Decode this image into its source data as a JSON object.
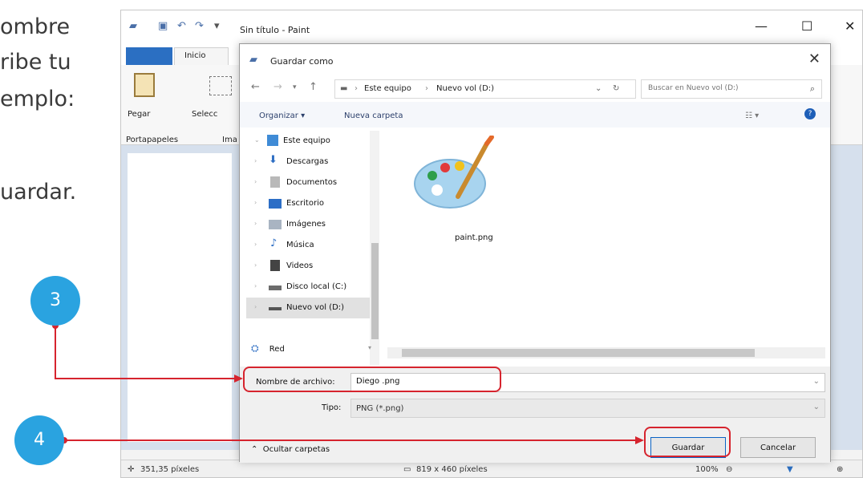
{
  "tutorial": {
    "line1": "ombre",
    "line2": "ribe tu",
    "line3": "emplo:",
    "line4": "uardar."
  },
  "paint": {
    "title": "Sin título - Paint",
    "tab_inicio": "Inicio",
    "paste_label": "Pegar",
    "select_label": "Selecc",
    "group_clipboard": "Portapapeles",
    "group_image": "Ima",
    "status_coords": "351,35 píxeles",
    "status_size": "819 x 460 píxeles",
    "status_zoom": "100%",
    "min_icon": "minimize-icon",
    "max_icon": "maximize-icon",
    "close_icon": "close-icon"
  },
  "dialog": {
    "title": "Guardar como",
    "breadcrumb": [
      "Este equipo",
      "Nuevo vol (D:)"
    ],
    "search_placeholder": "Buscar en Nuevo vol (D:)",
    "organize": "Organizar",
    "new_folder": "Nueva carpeta",
    "nav_items": [
      {
        "label": "Este equipo",
        "icon": "computer-icon"
      },
      {
        "label": "Descargas",
        "icon": "download-icon"
      },
      {
        "label": "Documentos",
        "icon": "documents-icon"
      },
      {
        "label": "Escritorio",
        "icon": "desktop-icon"
      },
      {
        "label": "Imágenes",
        "icon": "images-icon"
      },
      {
        "label": "Música",
        "icon": "music-icon"
      },
      {
        "label": "Videos",
        "icon": "videos-icon"
      },
      {
        "label": "Disco local (C:)",
        "icon": "disk-icon"
      },
      {
        "label": "Nuevo vol (D:)",
        "icon": "drive-icon"
      }
    ],
    "network": "Red",
    "file": {
      "name": "paint.png",
      "icon": "paint-palette-icon"
    },
    "filename_label": "Nombre de archivo:",
    "filename_value": "Diego .png",
    "type_label": "Tipo:",
    "type_value": "PNG (*.png)",
    "hide_folders": "Ocultar carpetas",
    "save": "Guardar",
    "cancel": "Cancelar"
  },
  "callouts": {
    "step3": "3",
    "step4": "4"
  },
  "colors": {
    "callout": "#2aa3e0",
    "highlight": "#d6242e",
    "accent": "#0b63c5"
  }
}
